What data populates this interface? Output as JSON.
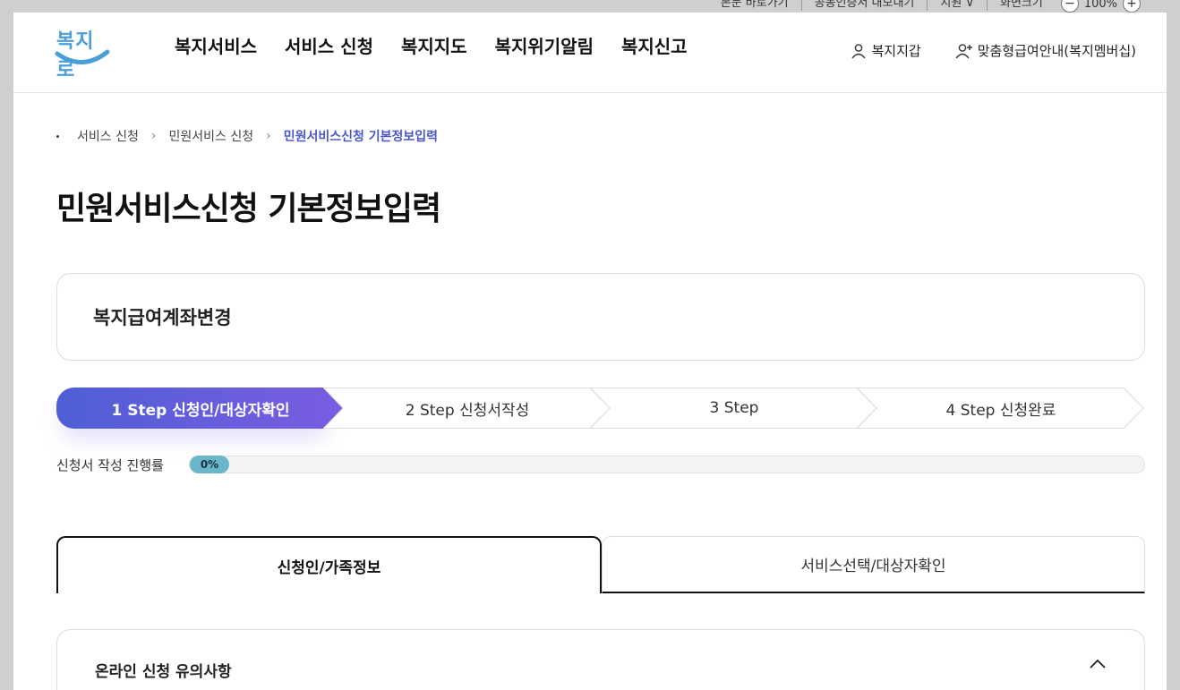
{
  "util": {
    "links": [
      "본문 바로가기",
      "공동인증서 내보내기",
      "지원 ∨",
      "화면크기"
    ],
    "zoom": "100%",
    "zoom_out": "−",
    "zoom_in": "+"
  },
  "logo": {
    "text": "복지로"
  },
  "nav": [
    "복지서비스",
    "서비스 신청",
    "복지지도",
    "복지위기알림",
    "복지신고"
  ],
  "member": {
    "wallet": "복지지갑",
    "membership": "맞춤형급여안내(복지멤버십)"
  },
  "breadcrumb": {
    "items": [
      "서비스 신청",
      "민원서비스 신청"
    ],
    "current": "민원서비스신청 기본정보입력"
  },
  "page_title": "민원서비스신청 기본정보입력",
  "service_name": "복지급여계좌변경",
  "steps": [
    {
      "label": "1 Step 신청인/대상자확인",
      "active": true
    },
    {
      "label": "2 Step 신청서작성",
      "active": false
    },
    {
      "label": "3 Step",
      "active": false
    },
    {
      "label": "4 Step 신청완료",
      "active": false
    }
  ],
  "progress": {
    "label": "신청서 작성 진행률",
    "value_text": "0%",
    "value": 0
  },
  "tabs": [
    {
      "label": "신청인/가족정보",
      "active": true
    },
    {
      "label": "서비스선택/대상자확인",
      "active": false
    }
  ],
  "notice": {
    "title": "온라인 신청 유의사항"
  },
  "colors": {
    "accent": "#4a57c8",
    "step_active_start": "#4f5fd6",
    "step_active_end": "#7a5de0",
    "progress_fill": "#6ab7c9"
  }
}
